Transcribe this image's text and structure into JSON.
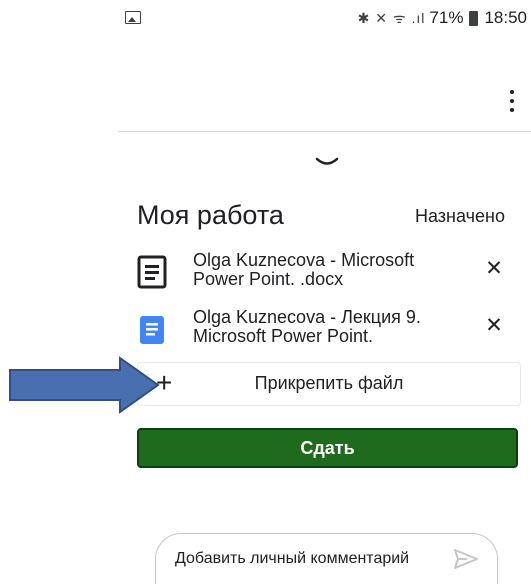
{
  "status_bar": {
    "icons": "✱ ✕ ᯤ .ıl",
    "battery": "71%",
    "time": "18:50"
  },
  "work": {
    "title": "Моя работа",
    "status": "Назначено"
  },
  "attachments": [
    {
      "name": "Olga Kuznecova - Microsoft Power Point. .docx",
      "icon": "docs-icon"
    },
    {
      "name": "Olga Kuznecova - Лекция 9. Microsoft Power Point.",
      "icon": "google-docs-icon"
    }
  ],
  "attach_button": {
    "label": "Прикрепить файл"
  },
  "submit_button": {
    "label": "Сдать"
  },
  "comment": {
    "placeholder": "Добавить личный комментарий"
  },
  "colors": {
    "submit_bg": "#1e6b1e",
    "arrow_fill": "#4a6fb0",
    "doc_blue": "#4285f4"
  }
}
